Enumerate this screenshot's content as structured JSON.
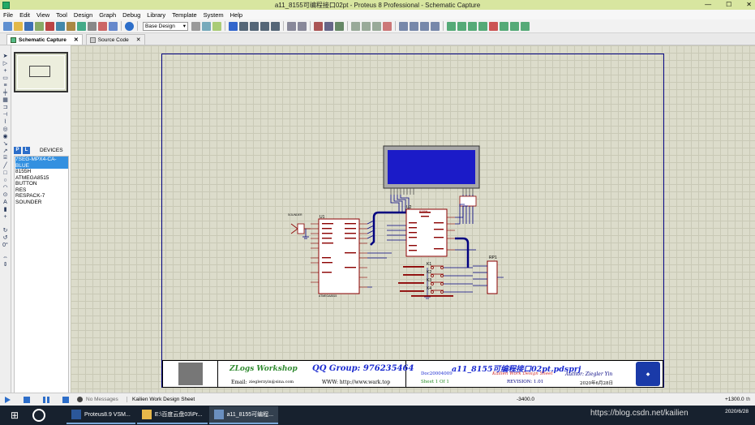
{
  "window": {
    "title": "a11_8155可编程接口02pt - Proteus 8 Professional - Schematic Capture",
    "minimize": "—",
    "maximize": "☐",
    "close": "✕"
  },
  "menu": [
    "File",
    "Edit",
    "View",
    "Tool",
    "Design",
    "Graph",
    "Debug",
    "Library",
    "Template",
    "System",
    "Help"
  ],
  "toolbar": {
    "design_select": "Base Design"
  },
  "tabs": [
    {
      "label": "Schematic Capture",
      "close": "✕"
    },
    {
      "label": "Source Code",
      "close": "✕"
    }
  ],
  "left_tools": {
    "rotation": "0°"
  },
  "devices": {
    "p_label": "P",
    "l_label": "L",
    "header": "DEVICES",
    "items": [
      "7SEG-MPX4-CA-BLUE",
      "8155H",
      "ATMEGA8515",
      "BUTTON",
      "RES",
      "RESPACK-7",
      "SOUNDER"
    ],
    "selected_index": 0
  },
  "schematic": {
    "labels": {
      "u1": "U1",
      "u2": "U2",
      "rp1": "RP1",
      "sounder": "SOUNDER",
      "u1_part": "ATMEGA8515",
      "u2_top": "8155H",
      "k1": "K1",
      "k2": "K2",
      "k3": "K3",
      "k4": "K4"
    }
  },
  "titleblock": {
    "logo_text": "ZLogs Workshop",
    "qq": "QQ Group: 976235464",
    "email_label": "Email:",
    "email": "zieglerzyin@sina.com",
    "www": "WWW: http://www.wark.top",
    "project": "a11_8155可编程接口02pt.pdsprj",
    "doc": "Doc20004009",
    "org": "Kailien Work Design Sheet",
    "sheet": "Sheet 1 Of 1",
    "revision": "REVISION: 1.01",
    "author": "Author: Ziegler Yin",
    "date": "2020年6月28日"
  },
  "status": {
    "messages": "No Messages",
    "sheet_name": "Kailien Work Design Sheet",
    "coord_x": "-3400.0",
    "coord_y": "+1300.0",
    "unit": "th"
  },
  "taskbar": {
    "items": [
      "Proteus8.9 VSM...",
      "E:\\百度云盘03\\Pr...",
      "a11_8155可编程..."
    ],
    "watermark": "https://blog.csdn.net/kailien",
    "time": "",
    "date": "2020/6/28"
  },
  "colors": {
    "lcd_blue": "#1b1bc8",
    "wire_blue": "#000080",
    "sheet_border": "#000080",
    "component_red": "#8b0000"
  }
}
